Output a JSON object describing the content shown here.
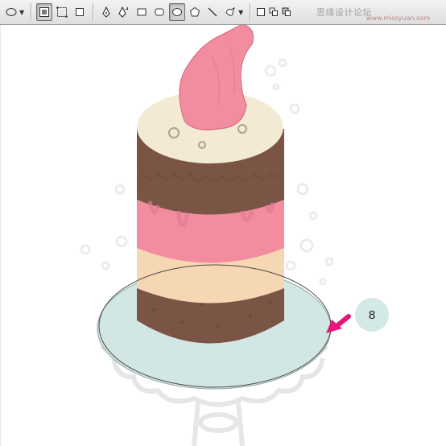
{
  "toolbar": {
    "tools": [
      {
        "name": "ellipse-preset-icon"
      },
      {
        "name": "shape-layers-icon"
      },
      {
        "name": "paths-icon"
      },
      {
        "name": "fill-pixels-icon"
      },
      {
        "name": "pen-icon"
      },
      {
        "name": "freeform-pen-icon"
      },
      {
        "name": "rectangle-icon"
      },
      {
        "name": "rounded-rectangle-icon"
      },
      {
        "name": "ellipse-icon"
      },
      {
        "name": "polygon-icon"
      },
      {
        "name": "line-icon"
      },
      {
        "name": "custom-shape-icon"
      },
      {
        "name": "new-layer-icon"
      },
      {
        "name": "add-to-area-icon"
      },
      {
        "name": "subtract-icon"
      }
    ],
    "watermark": "思缘设计论坛",
    "watermark_url": "www.missyuan.com"
  },
  "canvas": {
    "step_label": "8"
  },
  "colors": {
    "toolbar_bg": "#e6e6e6",
    "cream_top": "#f2ead2",
    "chocolate": "#7a5545",
    "strawberry": "#f28da0",
    "vanilla": "#f5d7b3",
    "plate": "#d2e7e4",
    "arrow": "#e4177a",
    "badge": "#d4e8e6"
  }
}
